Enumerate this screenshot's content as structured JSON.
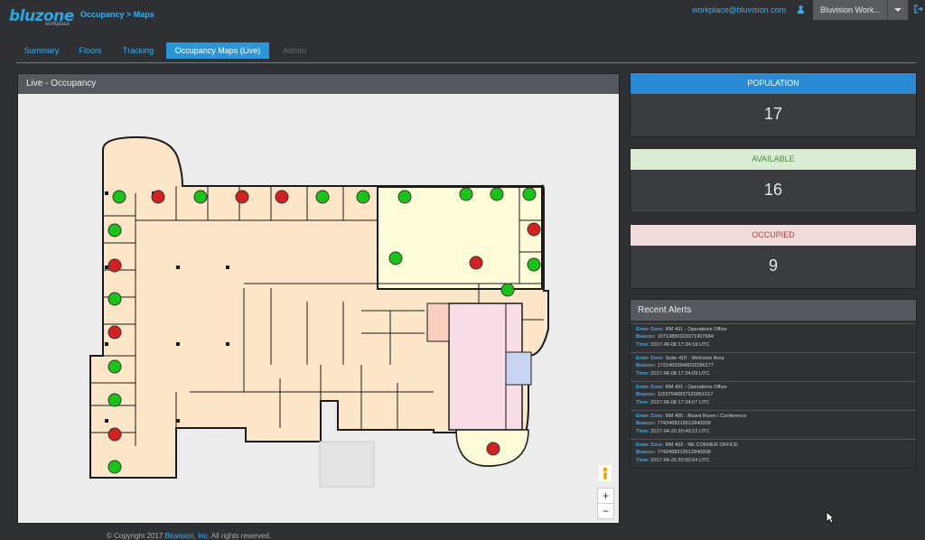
{
  "app": {
    "logo": "bluzone",
    "logo_sub": "workplace",
    "breadcrumb": "Occupancy > Maps",
    "user_email": "workplace@bluvision.com",
    "org_selector": "Bluvision Work..."
  },
  "tabs": [
    {
      "label": "Summary"
    },
    {
      "label": "Floors"
    },
    {
      "label": "Tracking"
    },
    {
      "label": "Occupancy Maps (Live)"
    },
    {
      "label": "Admin"
    }
  ],
  "map_panel": {
    "title": "Live - Occupancy",
    "zoom_in": "+",
    "zoom_out": "−",
    "status_colors": {
      "available": "#19c419",
      "occupied": "#d32121"
    }
  },
  "stats": {
    "population": {
      "label": "POPULATION",
      "value": "17",
      "color": "#2a8ad4"
    },
    "available": {
      "label": "AVAILABLE",
      "value": "16",
      "color": "#d9ecd2"
    },
    "occupied": {
      "label": "OCCUPIED",
      "value": "9",
      "color": "#f0dada"
    }
  },
  "alerts": {
    "title": "Recent Alerts",
    "field_labels": {
      "zone": "Enter Zone:",
      "beacon": "Beacon:",
      "time": "Time:"
    },
    "items": [
      {
        "zone": "RM 401 - Operations Office",
        "beacon": "10713890329371907684",
        "time": "2017-06-08 17:34:19 UTC"
      },
      {
        "zone": "Suite 410 - Welcome Area",
        "beacon": "17214093948032296277",
        "time": "2017-06-08 17:34:09 UTC"
      },
      {
        "zone": "RM 401 - Operations Office",
        "beacon": "11537546837620951017",
        "time": "2017-06-08 17:34:07 UTC"
      },
      {
        "zone": "RM 405 - Board Room / Conference",
        "beacon": "7742468319512840008",
        "time": "2017-04-20 20:49:22 UTC"
      },
      {
        "zone": "RM 402 - NE CORNER OFFICE",
        "beacon": "7742468319512840008",
        "time": "2017-04-20 20:50:54 UTC"
      }
    ]
  },
  "footer": {
    "copyright": "© Copyright 2017",
    "company": "Bluvision, Inc.",
    "rights": "All rights reserved."
  }
}
